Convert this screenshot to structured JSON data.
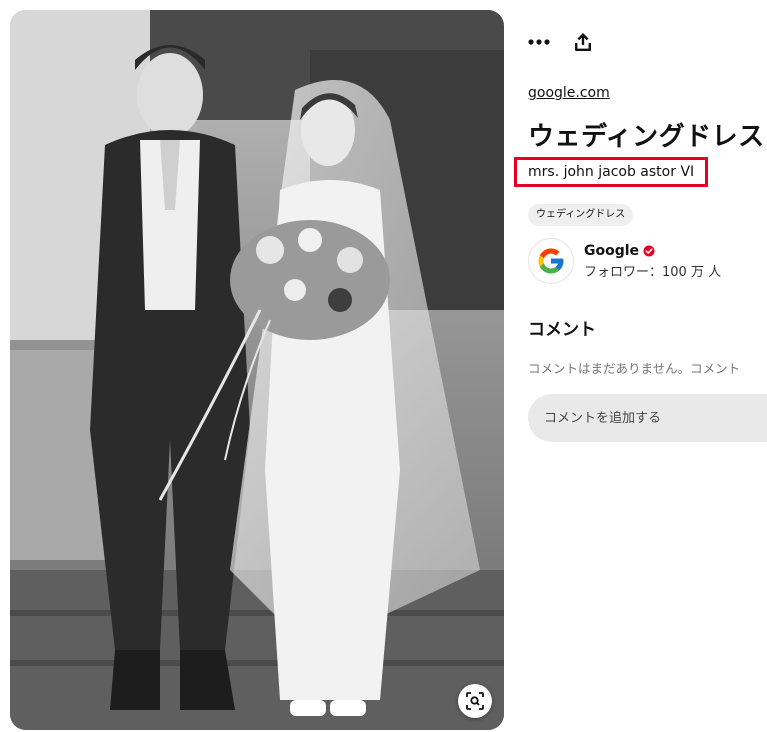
{
  "image": {
    "alt": "",
    "visual_search_icon": "lens-scan-icon"
  },
  "toolbar": {
    "more_icon": "more-horizontal-icon",
    "share_icon": "share-upload-icon"
  },
  "pin": {
    "source": "google.com",
    "title": "ウェディングドレス",
    "description": "mrs. john jacob astor VI",
    "tag": "ウェディングドレス"
  },
  "author": {
    "name": "Google",
    "followers": "フォロワー：100 万 人",
    "verified_icon": "verified-badge-icon"
  },
  "comments": {
    "heading": "コメント",
    "empty_text": "コメントはまだありません。コメント",
    "input_placeholder": "コメントを追加する"
  },
  "colors": {
    "highlight": "#e60023",
    "verified": "#e60023",
    "chip_bg": "#efefef",
    "input_bg": "#e9e9e9"
  }
}
